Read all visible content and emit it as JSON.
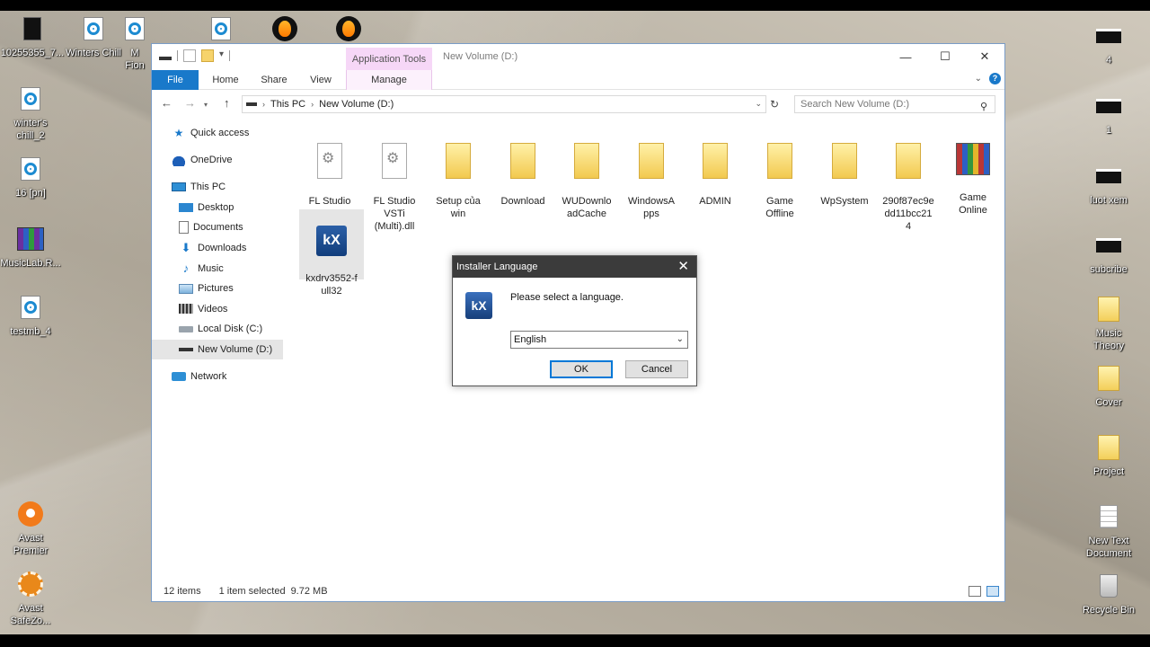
{
  "desktop": {
    "left_icons": [
      {
        "label": "10255355_7...",
        "icon": "video-thumbnail-icon"
      },
      {
        "label": "Winters Chill",
        "icon": "audio-file-icon"
      },
      {
        "label": "M\nFion",
        "icon": "audio-file-icon"
      },
      {
        "label": "",
        "icon": "audio-file-icon"
      },
      {
        "label": "",
        "icon": "fl-studio-icon"
      },
      {
        "label": "",
        "icon": "fl-studio-icon"
      },
      {
        "label": "winter's\nchill_2",
        "icon": "audio-file-icon"
      },
      {
        "label": "16 [pn]",
        "icon": "audio-file-icon"
      },
      {
        "label": "MusicLab.R...",
        "icon": "winrar-icon"
      },
      {
        "label": "testmb_4",
        "icon": "audio-file-icon"
      },
      {
        "label": "Avast\nPremier",
        "icon": "avast-icon"
      },
      {
        "label": "Avast\nSafeZo...",
        "icon": "avast-safezone-icon"
      }
    ],
    "right_icons": [
      {
        "label": "4",
        "icon": "video-thumbnail-icon"
      },
      {
        "label": "1",
        "icon": "video-thumbnail-icon"
      },
      {
        "label": "luot xem",
        "icon": "video-thumbnail-icon"
      },
      {
        "label": "subcribe",
        "icon": "video-thumbnail-icon"
      },
      {
        "label": "Music\nTheory",
        "icon": "folder-icon"
      },
      {
        "label": "Cover",
        "icon": "folder-icon"
      },
      {
        "label": "Project",
        "icon": "folder-icon"
      },
      {
        "label": "New Text\nDocument",
        "icon": "text-document-icon"
      },
      {
        "label": "Recycle Bin",
        "icon": "recycle-bin-icon"
      }
    ]
  },
  "explorer": {
    "context_tab": "Application Tools",
    "title": "New Volume (D:)",
    "tabs": {
      "file": "File",
      "home": "Home",
      "share": "Share",
      "view": "View",
      "manage": "Manage"
    },
    "address": {
      "crumbs": [
        "This PC",
        "New Volume (D:)"
      ]
    },
    "search_placeholder": "Search New Volume (D:)",
    "nav_pane": {
      "quick_access": "Quick access",
      "onedrive": "OneDrive",
      "this_pc": "This PC",
      "desktop": "Desktop",
      "documents": "Documents",
      "downloads": "Downloads",
      "music": "Music",
      "pictures": "Pictures",
      "videos": "Videos",
      "local_disk": "Local Disk (C:)",
      "new_volume": "New Volume (D:)",
      "network": "Network"
    },
    "files": [
      {
        "name": "FL Studio\nVSTi.dll",
        "type": "dll"
      },
      {
        "name": "FL Studio\nVSTi\n(Multi).dll",
        "type": "dll"
      },
      {
        "name": "Setup của\nwin",
        "type": "folder"
      },
      {
        "name": "Download",
        "type": "folder"
      },
      {
        "name": "WUDownlo\nadCache",
        "type": "folder"
      },
      {
        "name": "WindowsA\npps",
        "type": "folder"
      },
      {
        "name": "ADMIN",
        "type": "folder"
      },
      {
        "name": "Game\nOffline",
        "type": "folder"
      },
      {
        "name": "WpSystem",
        "type": "folder"
      },
      {
        "name": "290f87ec9e\ndd11bcc21\n4",
        "type": "folder"
      },
      {
        "name": "Game\nOnline",
        "type": "winrar"
      },
      {
        "name": "kxdrv3552-f\null32",
        "type": "installer",
        "selected": true
      }
    ],
    "status": {
      "count": "12 items",
      "selected": "1 item selected",
      "size": "9.72 MB"
    }
  },
  "dialog": {
    "title": "Installer Language",
    "prompt": "Please select a language.",
    "language": "English",
    "ok": "OK",
    "cancel": "Cancel"
  },
  "colors": {
    "accent": "#1979ca",
    "context_tab": "#f6d7f7",
    "dialog_title": "#3b3b3b"
  }
}
